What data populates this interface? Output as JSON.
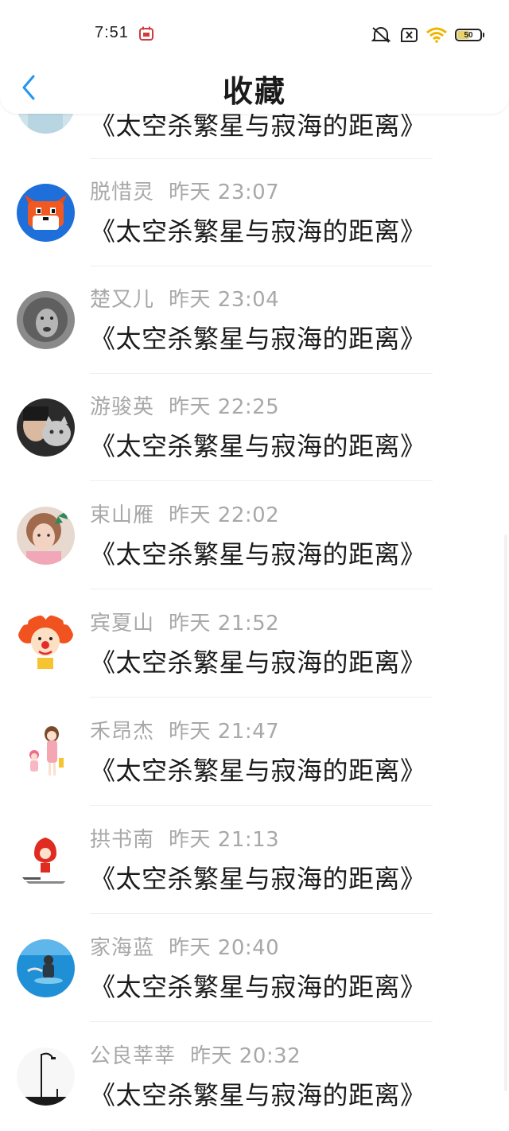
{
  "status_bar": {
    "time": "7:51",
    "battery": "50",
    "icons": [
      "calendar-icon",
      "mute-icon",
      "sim-off-icon",
      "wifi-icon",
      "battery-icon"
    ]
  },
  "header": {
    "back_icon": "chevron-left-icon",
    "title": "收藏",
    "accent_color": "#2196f3"
  },
  "items": [
    {
      "name": "",
      "time": "",
      "title": "《太空杀繁星与寂海的距离》",
      "avatar": "blurred-person-avatar"
    },
    {
      "name": "脱惜灵",
      "time": "昨天 23:07",
      "title": "《太空杀繁星与寂海的距离》",
      "avatar": "pixel-fox-avatar"
    },
    {
      "name": "楚又儿",
      "time": "昨天 23:04",
      "title": "《太空杀繁星与寂海的距离》",
      "avatar": "lion-avatar"
    },
    {
      "name": "游骏英",
      "time": "昨天 22:25",
      "title": "《太空杀繁星与寂海的距离》",
      "avatar": "person-with-cat-avatar"
    },
    {
      "name": "束山雁",
      "time": "昨天 22:02",
      "title": "《太空杀繁星与寂海的距离》",
      "avatar": "girl-with-bow-avatar"
    },
    {
      "name": "宾夏山",
      "time": "昨天 21:52",
      "title": "《太空杀繁星与寂海的距离》",
      "avatar": "clown-avatar"
    },
    {
      "name": "禾昂杰",
      "time": "昨天 21:47",
      "title": "《太空杀繁星与寂海的距离》",
      "avatar": "cartoon-girls-avatar"
    },
    {
      "name": "拱书南",
      "time": "昨天 21:13",
      "title": "《太空杀繁星与寂海的距离》",
      "avatar": "red-hood-avatar"
    },
    {
      "name": "家海蓝",
      "time": "昨天 20:40",
      "title": "《太空杀繁星与寂海的距离》",
      "avatar": "sea-swimmer-avatar"
    },
    {
      "name": "公良莘莘",
      "time": "昨天 20:32",
      "title": "《太空杀繁星与寂海的距离》",
      "avatar": "streetlamp-avatar"
    }
  ]
}
